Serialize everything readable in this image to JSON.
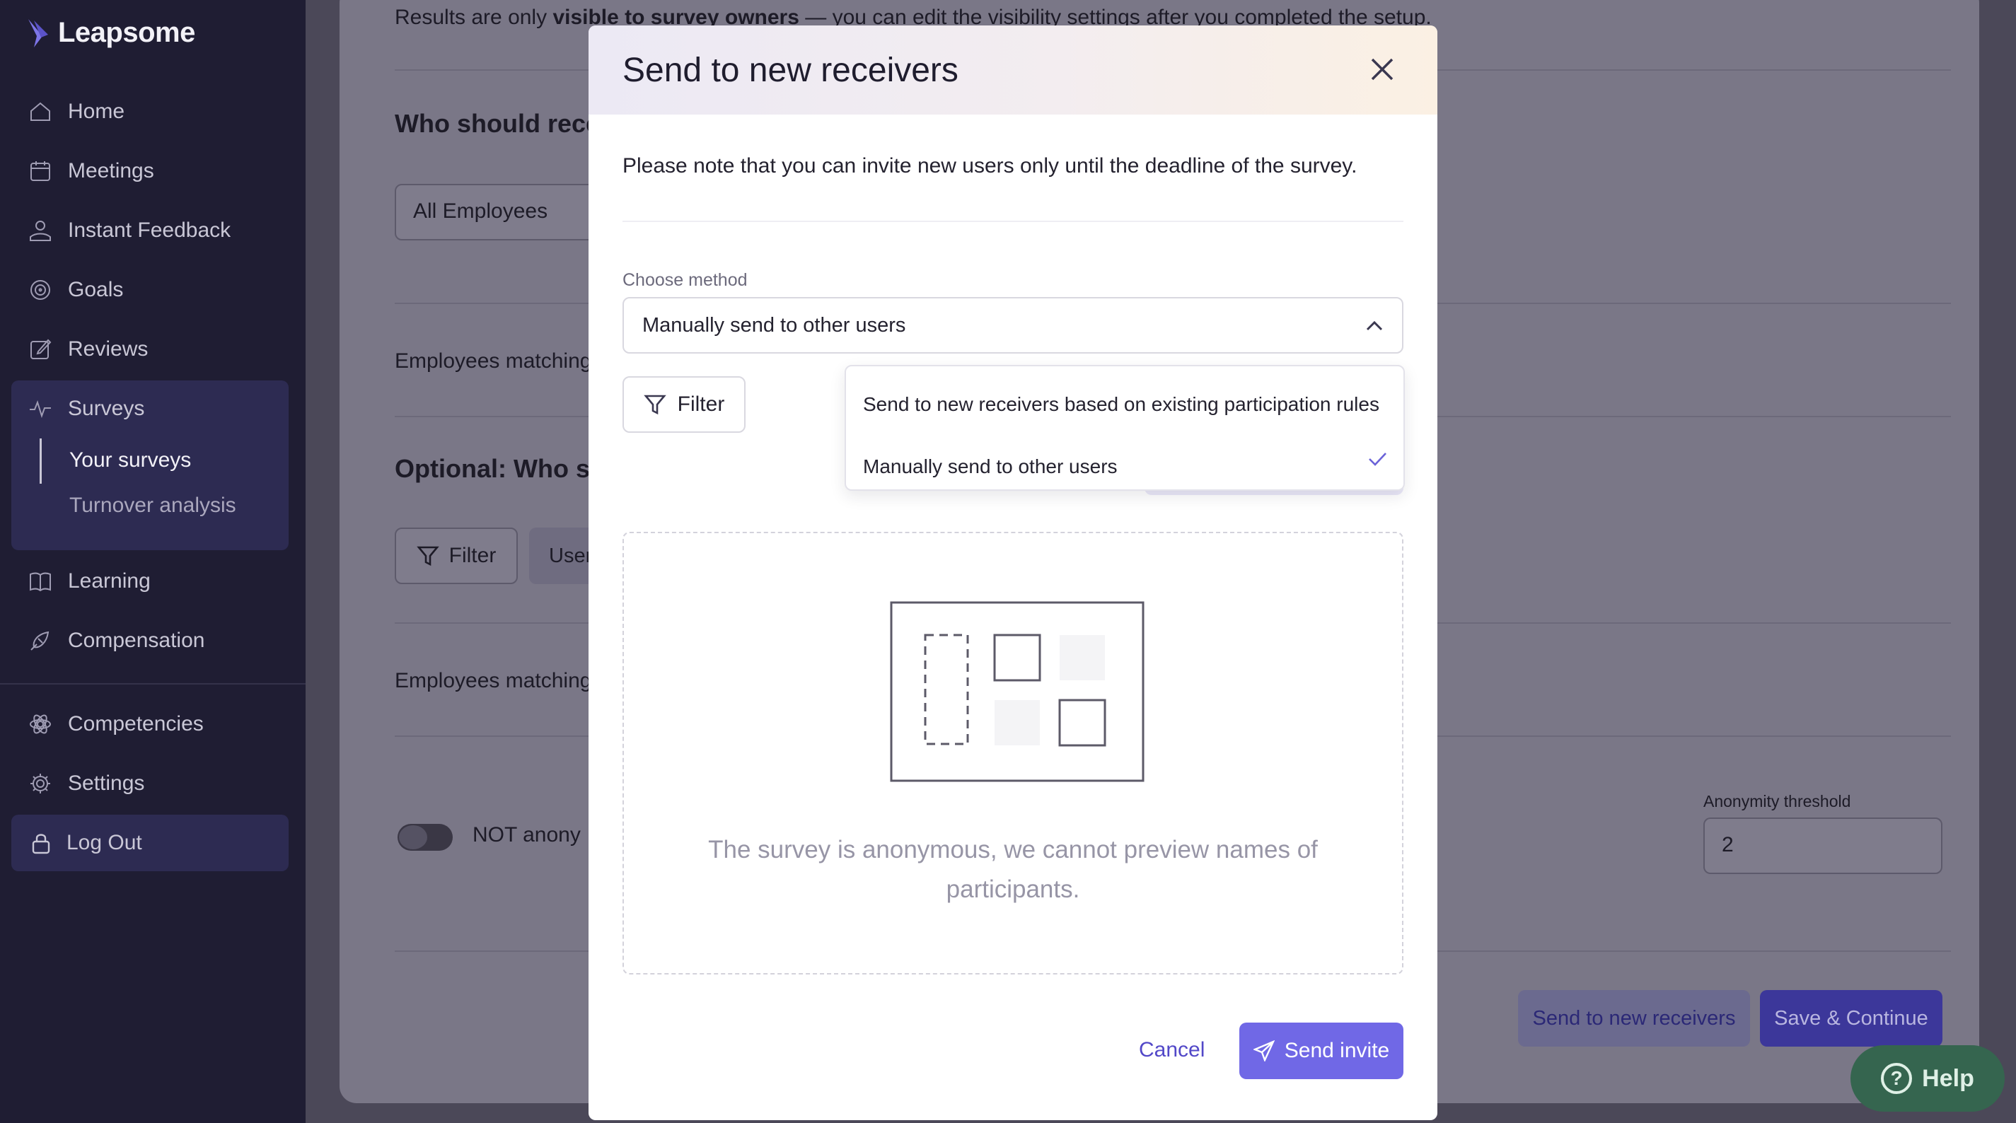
{
  "sidebar": {
    "brand": "Leapsome",
    "items": [
      {
        "label": "Home",
        "icon": "home-icon"
      },
      {
        "label": "Meetings",
        "icon": "meetings-icon"
      },
      {
        "label": "Instant Feedback",
        "icon": "instant-feedback-icon"
      },
      {
        "label": "Goals",
        "icon": "goals-icon"
      },
      {
        "label": "Reviews",
        "icon": "reviews-icon"
      },
      {
        "label": "Surveys",
        "icon": "surveys-icon"
      },
      {
        "label": "Learning",
        "icon": "learning-icon"
      },
      {
        "label": "Compensation",
        "icon": "compensation-icon"
      },
      {
        "label": "Competencies",
        "icon": "competencies-icon"
      },
      {
        "label": "Settings",
        "icon": "settings-icon"
      }
    ],
    "surveys_sub": [
      "Your surveys",
      "Turnover analysis"
    ],
    "logout": "Log Out"
  },
  "background": {
    "visibility_note_start": "Results are only ",
    "visibility_note_bold": "visible to survey owners",
    "visibility_note_end": " — you can edit the visibility settings after you completed the setup.",
    "who_receives_heading": "Who should rece",
    "all_employees": "All Employees",
    "employees_matching_1": "Employees matching",
    "optional_heading": "Optional: Who s",
    "filter_label": "Filter",
    "users_label": "User",
    "employees_matching_2": "Employees matching",
    "not_anonymous": "NOT anony",
    "anonymity_label": "Anonymity threshold",
    "anonymity_value": "2",
    "send_new_receivers": "Send to new receivers",
    "save_continue": "Save & Continue"
  },
  "modal": {
    "title": "Send to new receivers",
    "note": "Please note that you can invite new users only until the deadline of the survey.",
    "method_label": "Choose method",
    "method_selected": "Manually send to other users",
    "filter_label": "Filter",
    "options": [
      "Send to new receivers based on existing participation rules",
      "Manually send to other users"
    ],
    "selected_option_index": 1,
    "empty_text": "The survey is anonymous, we cannot preview names of participants.",
    "cancel": "Cancel",
    "send": "Send invite"
  },
  "help": {
    "label": "Help"
  },
  "colors": {
    "sidebar_bg": "#1f1d33",
    "accent": "#7068e6",
    "accent_text": "#5248c8",
    "help_bg": "#35654f"
  }
}
